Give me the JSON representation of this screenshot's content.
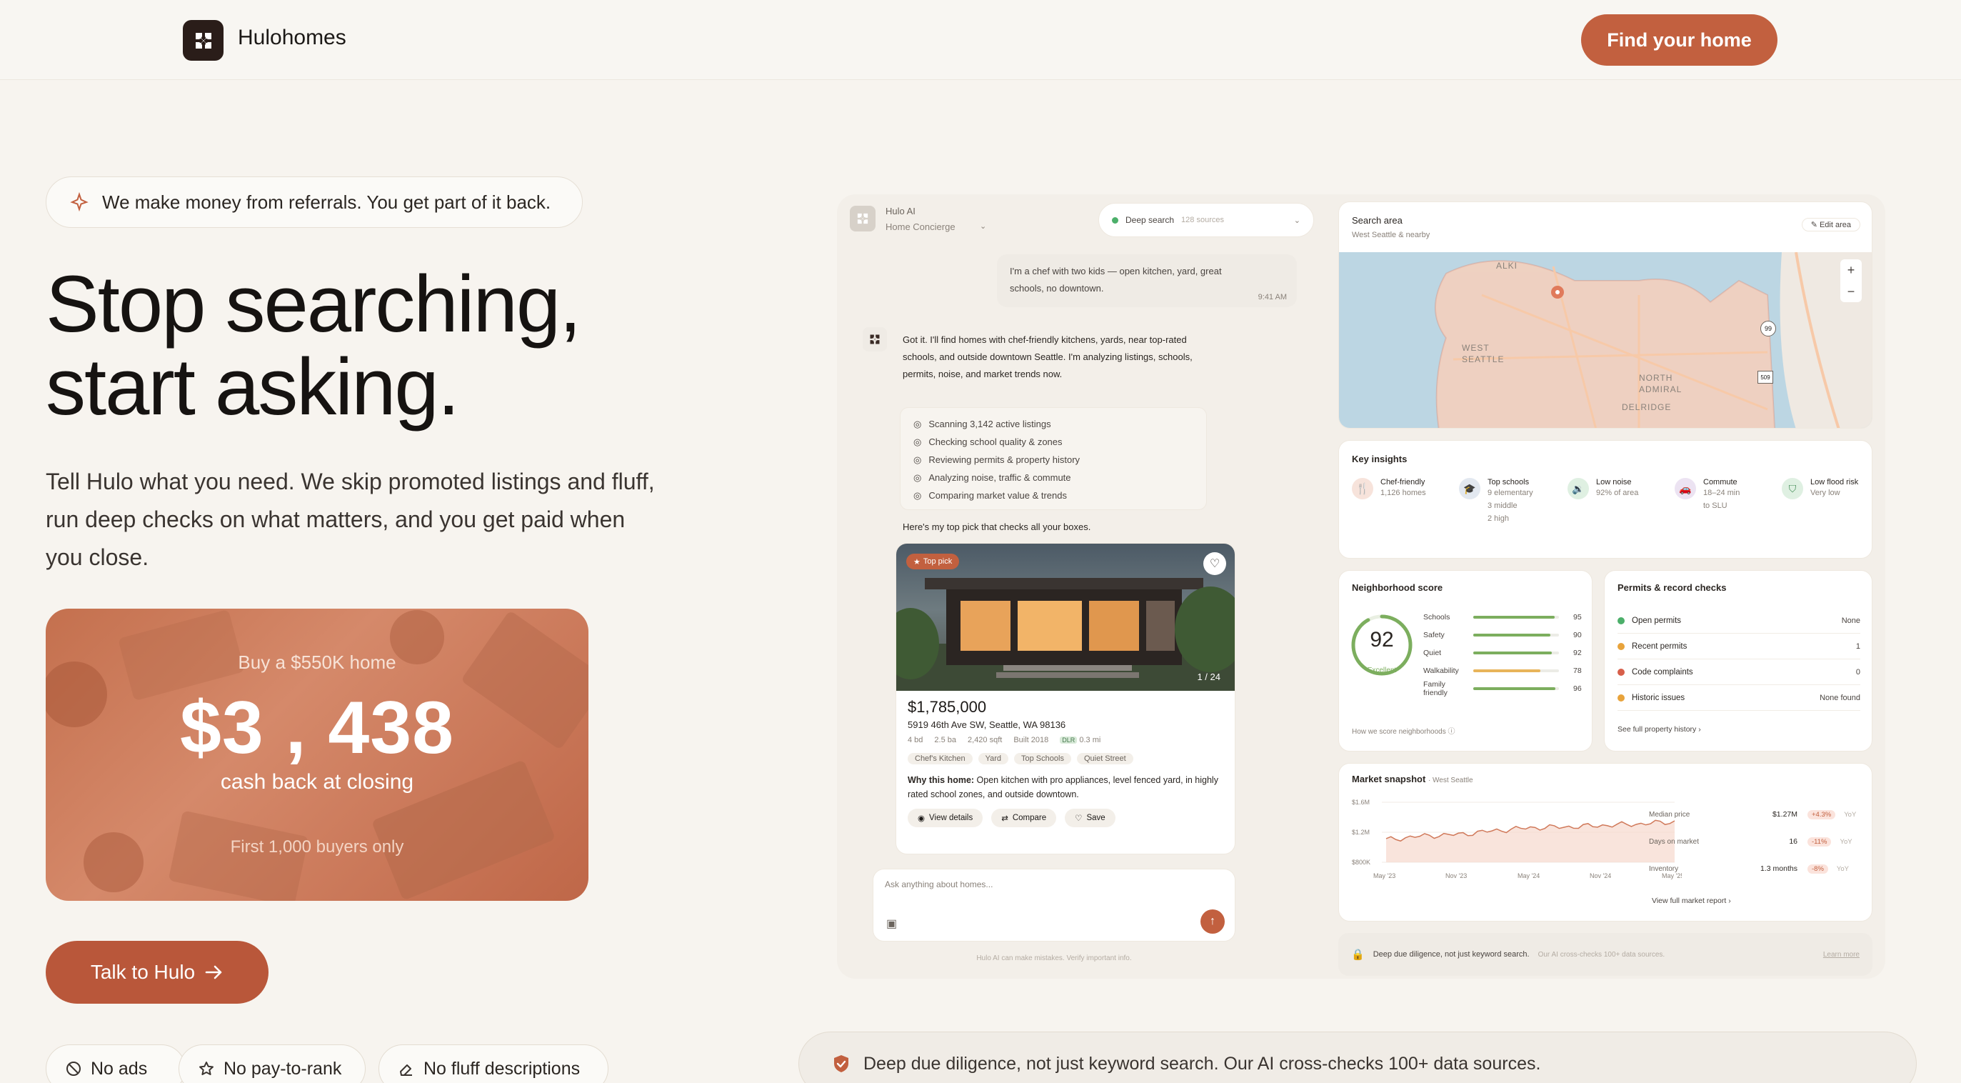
{
  "header": {
    "brand": "Hulohomes",
    "cta": "Find your home"
  },
  "hero": {
    "pill": "We make money from referrals. You get part of it back.",
    "title_line1": "Stop searching,",
    "title_line2": "start asking.",
    "lead": "Tell Hulo what you need. We skip promoted listings and fluff, run deep checks on what matters, and you get paid when you close.",
    "promo": {
      "line1": "Buy a $550K home",
      "amount": "$3 , 438",
      "line2": "cash back at closing",
      "line3": "First 1,000 buyers only"
    },
    "talk": "Talk to Hulo",
    "features": [
      "No ads",
      "No pay-to-rank",
      "No fluff descriptions"
    ]
  },
  "chat": {
    "assistant_name": "Hulo AI",
    "assistant_role": "Home Concierge",
    "mode": "Deep search",
    "sources": "128 sources",
    "user_msg": "I'm a chef with two kids — open kitchen, yard, great schools, no downtown.",
    "user_time": "9:41 AM",
    "bot_msg": "Got it. I'll find homes with chef-friendly kitchens, yards, near top-rated schools, and outside downtown Seattle. I'm analyzing listings, schools, permits, noise, and market trends now.",
    "steps": [
      "Scanning 3,142 active listings",
      "Checking school quality & zones",
      "Reviewing permits & property history",
      "Analyzing noise, traffic & commute",
      "Comparing market value & trends"
    ],
    "pick_intro": "Here's my top pick that checks all your boxes.",
    "listing": {
      "badge": "Top pick",
      "counter": "1 / 24",
      "price": "$1,785,000",
      "address": "5919 46th Ave SW, Seattle, WA 98136",
      "beds": "4 bd",
      "baths": "2.5 ba",
      "sqft": "2,420 sqft",
      "built": "Built 2018",
      "dlr": "DLR",
      "dist": "0.3 mi",
      "tags": [
        "Chef's Kitchen",
        "Yard",
        "Top Schools",
        "Quiet Street"
      ],
      "why_label": "Why this home:",
      "why": "Open kitchen with pro appliances, level fenced yard, in highly rated school zones, and outside downtown.",
      "actions": [
        "View details",
        "Compare",
        "Save"
      ]
    },
    "input_placeholder": "Ask anything about homes...",
    "disclaimer": "Hulo AI can make mistakes. Verify important info."
  },
  "map": {
    "title": "Search area",
    "subtitle": "West Seattle & nearby",
    "edit": "Edit area",
    "labels": [
      "ALKI",
      "WEST SEATTLE",
      "NORTH ADMIRAL",
      "DELRIDGE"
    ],
    "road1": "99",
    "road2": "509"
  },
  "insights": {
    "title": "Key insights",
    "items": [
      {
        "icon": "utensils-icon",
        "label": "Chef-friendly",
        "sub": "1,126 homes"
      },
      {
        "icon": "school-icon",
        "label": "Top schools",
        "sub": "9 elementary\n3 middle\n2 high"
      },
      {
        "icon": "speaker-icon",
        "label": "Low noise",
        "sub": "92% of area"
      },
      {
        "icon": "car-icon",
        "label": "Commute",
        "sub": "18–24 min\nto SLU"
      },
      {
        "icon": "shield-icon",
        "label": "Low flood risk",
        "sub": "Very low"
      }
    ]
  },
  "neighborhood": {
    "title": "Neighborhood score",
    "score": "92",
    "grade": "Excellent",
    "rows": [
      {
        "label": "Schools",
        "value": 95
      },
      {
        "label": "Safety",
        "value": 90
      },
      {
        "label": "Quiet",
        "value": 92
      },
      {
        "label": "Walkability",
        "value": 78
      },
      {
        "label": "Family friendly",
        "value": 96
      }
    ],
    "footer": "How we score neighborhoods"
  },
  "permits": {
    "title": "Permits & record checks",
    "rows": [
      {
        "label": "Open permits",
        "value": "None",
        "color": "#4caf6a"
      },
      {
        "label": "Recent permits",
        "value": "1",
        "color": "#e8a33b"
      },
      {
        "label": "Code complaints",
        "value": "0",
        "color": "#d75f4a"
      },
      {
        "label": "Historic issues",
        "value": "None found",
        "color": "#e8a33b"
      }
    ],
    "footer": "See full property history"
  },
  "market": {
    "title": "Market snapshot",
    "area": "West Seattle",
    "yticks": [
      "$1.6M",
      "$1.2M",
      "$800K"
    ],
    "xticks": [
      "May '23",
      "Nov '23",
      "May '24",
      "Nov '24",
      "May '25"
    ],
    "stats": [
      {
        "label": "Median price",
        "value": "$1.27M",
        "delta": "+4.3%",
        "period": "YoY"
      },
      {
        "label": "Days on market",
        "value": "16",
        "delta": "-11%",
        "period": "YoY"
      },
      {
        "label": "Inventory",
        "value": "1.3 months",
        "delta": "-8%",
        "period": "YoY"
      }
    ],
    "footer": "View full market report"
  },
  "diligence_small": {
    "text": "Deep due diligence, not just keyword search.",
    "sub": "Our AI cross-checks 100+ data sources.",
    "link": "Learn more"
  },
  "bottom_bar": "Deep due diligence, not just keyword search. Our AI cross-checks 100+ data sources.",
  "chart_data": {
    "type": "area",
    "title": "Market snapshot",
    "x": [
      "May '23",
      "Aug '23",
      "Nov '23",
      "Feb '24",
      "May '24",
      "Aug '24",
      "Nov '24",
      "Feb '25",
      "May '25"
    ],
    "series": [
      {
        "values": [
          1.1,
          1.15,
          1.17,
          1.22,
          1.26,
          1.27,
          1.29,
          1.31,
          1.34
        ]
      }
    ],
    "ylim": [
      0.8,
      1.6
    ],
    "ylabel": "",
    "xlabel": ""
  }
}
